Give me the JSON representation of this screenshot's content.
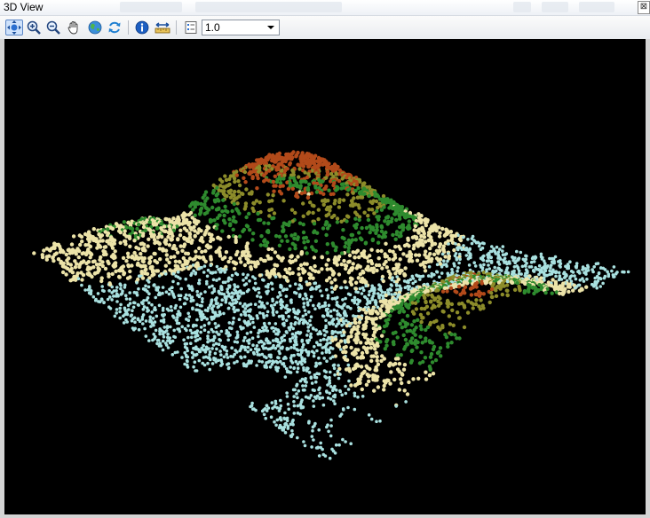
{
  "window": {
    "title": "3D View",
    "close_symbol": "⊠"
  },
  "toolbar": {
    "tools": [
      {
        "name": "navigate-icon",
        "active": true
      },
      {
        "name": "zoom-in-icon"
      },
      {
        "name": "zoom-out-icon"
      },
      {
        "name": "pan-hand-icon"
      },
      {
        "name": "full-extent-globe-icon"
      },
      {
        "name": "refresh-icon"
      },
      {
        "name": "identify-info-icon"
      },
      {
        "name": "measure-ruler-icon"
      },
      {
        "name": "properties-icon"
      }
    ],
    "scale_value": "1.0"
  },
  "scene": {
    "background": "#000000",
    "point_colors": {
      "water": "#a8e0df",
      "lowland": "#ece3a8",
      "forest": "#2e8b2e",
      "upland": "#8c8c2a",
      "peak": "#b24a1a"
    }
  }
}
